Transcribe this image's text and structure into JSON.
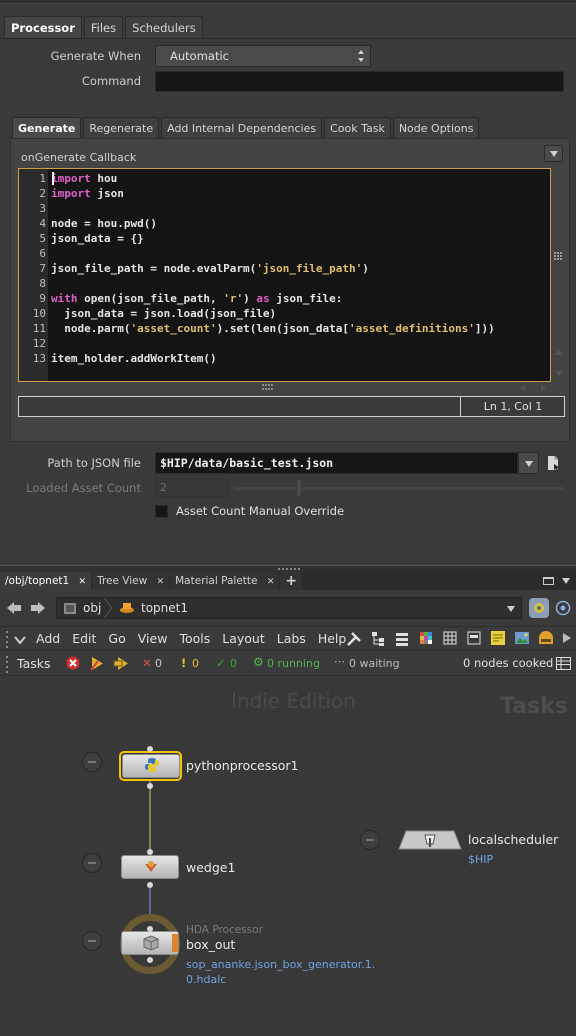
{
  "param_tabs": [
    "Processor",
    "Files",
    "Schedulers"
  ],
  "generate_when": {
    "label": "Generate When",
    "value": "Automatic"
  },
  "command": {
    "label": "Command",
    "value": ""
  },
  "callback_tabs": [
    "Generate",
    "Regenerate",
    "Add Internal Dependencies",
    "Cook Task",
    "Node Options"
  ],
  "callback_label": "onGenerate Callback",
  "code_lines": [
    {
      "n": "1",
      "html": "<span class='kw'>import</span> hou"
    },
    {
      "n": "2",
      "html": "<span class='kw'>import</span> json"
    },
    {
      "n": "3",
      "html": ""
    },
    {
      "n": "4",
      "html": "node = hou.pwd()"
    },
    {
      "n": "5",
      "html": "json_data = {}"
    },
    {
      "n": "6",
      "html": ""
    },
    {
      "n": "7",
      "html": "json_file_path = node.evalParm(<span class='str'>'json_file_path'</span>)"
    },
    {
      "n": "8",
      "html": ""
    },
    {
      "n": "9",
      "html": "<span class='kw'>with</span> open(json_file_path, <span class='str'>'r'</span>) <span class='kw'>as</span> json_file:"
    },
    {
      "n": "10",
      "html": "  json_data = json.load(json_file)"
    },
    {
      "n": "11",
      "html": "  node.parm(<span class='str'>'asset_count'</span>).set(len(json_data[<span class='str'>'asset_definitions'</span>]))"
    },
    {
      "n": "12",
      "html": ""
    },
    {
      "n": "13",
      "html": "item_holder.addWorkItem()"
    }
  ],
  "cursor_status": "Ln 1, Col 1",
  "path_json": {
    "label": "Path to JSON file",
    "value": "$HIP/data/basic_test.json"
  },
  "loaded_count": {
    "label": "Loaded Asset Count",
    "value": "2"
  },
  "override_label": "Asset Count Manual Override",
  "pane_tabs": [
    "/obj/topnet1",
    "Tree View",
    "Material Palette"
  ],
  "path_bar": {
    "obj": "obj",
    "topnet": "topnet1"
  },
  "menu": [
    "Add",
    "Edit",
    "Go",
    "View",
    "Tools",
    "Layout",
    "Labs",
    "Help"
  ],
  "tasks_bar": {
    "label": "Tasks",
    "failed": "0",
    "warnings": "0",
    "success": "0",
    "running": "0 running",
    "waiting": "0 waiting",
    "cooked": "0 nodes cooked"
  },
  "watermark": {
    "edition": "Indie Edition",
    "context": "Tasks"
  },
  "nodes": {
    "python": "pythonprocessor1",
    "wedge": "wedge1",
    "box_type": "HDA Processor",
    "box": "box_out",
    "box_hda_line1": "sop_ananke.json_box_generator.1.",
    "box_hda_line2": "0.hdalc",
    "scheduler": "localscheduler",
    "scheduler_path": "$HIP"
  },
  "colors": {
    "selected": "#f4c400",
    "link_blue": "#6fa3e0",
    "keyword": "#e060c8",
    "string": "#e0c070"
  }
}
